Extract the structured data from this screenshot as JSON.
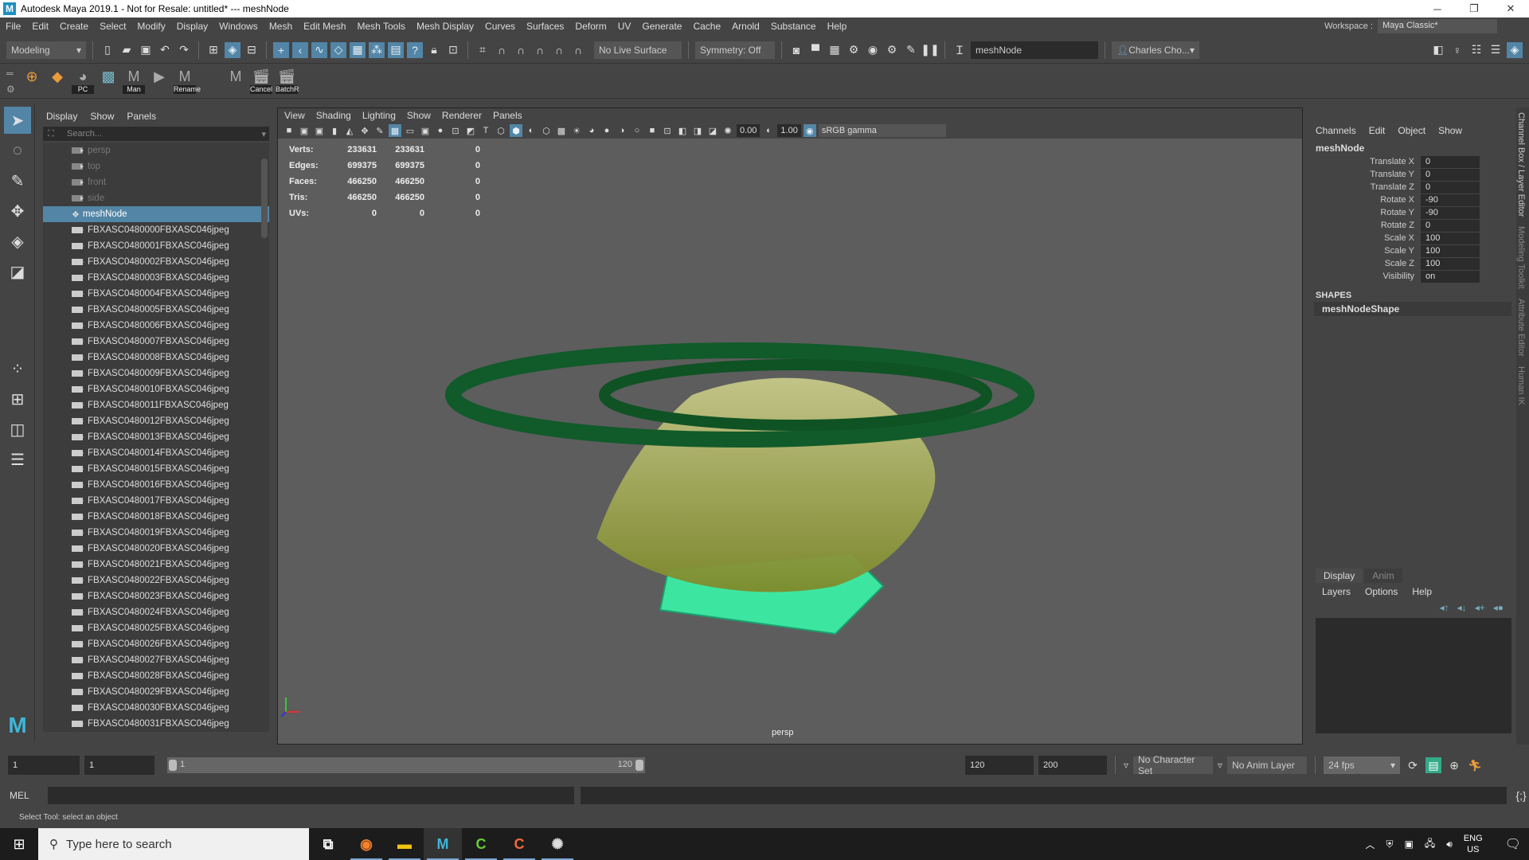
{
  "titlebar": {
    "title": "Autodesk Maya 2019.1 - Not for Resale: untitled*   ---   meshNode",
    "minimize": "─",
    "maximize": "❐",
    "close": "✕"
  },
  "menubar": {
    "items": [
      "File",
      "Edit",
      "Create",
      "Select",
      "Modify",
      "Display",
      "Windows",
      "Mesh",
      "Edit Mesh",
      "Mesh Tools",
      "Mesh Display",
      "Curves",
      "Surfaces",
      "Deform",
      "UV",
      "Generate",
      "Cache",
      "Arnold",
      "Substance",
      "Help"
    ],
    "workspace_label": "Workspace :",
    "workspace_value": "Maya Classic*"
  },
  "statusline": {
    "menuset": "Modeling",
    "live_surface": "No Live Surface",
    "symmetry": "Symmetry: Off",
    "name_field": "meshNode",
    "user": "Charles Cho..."
  },
  "shelf": {
    "buttons": [
      "PC",
      "Man",
      "Rename",
      "Cancel",
      "BatchR"
    ]
  },
  "outliner": {
    "menu": [
      "Display",
      "Show",
      "Panels"
    ],
    "search_placeholder": "Search...",
    "items": [
      {
        "label": "persp",
        "type": "camera",
        "dim": true
      },
      {
        "label": "top",
        "type": "camera",
        "dim": true
      },
      {
        "label": "front",
        "type": "camera",
        "dim": true
      },
      {
        "label": "side",
        "type": "camera",
        "dim": true
      },
      {
        "label": "meshNode",
        "type": "mesh",
        "selected": true
      },
      {
        "label": "FBXASC0480000FBXASC046jpeg",
        "type": "camera"
      },
      {
        "label": "FBXASC0480001FBXASC046jpeg",
        "type": "camera"
      },
      {
        "label": "FBXASC0480002FBXASC046jpeg",
        "type": "camera"
      },
      {
        "label": "FBXASC0480003FBXASC046jpeg",
        "type": "camera"
      },
      {
        "label": "FBXASC0480004FBXASC046jpeg",
        "type": "camera"
      },
      {
        "label": "FBXASC0480005FBXASC046jpeg",
        "type": "camera"
      },
      {
        "label": "FBXASC0480006FBXASC046jpeg",
        "type": "camera"
      },
      {
        "label": "FBXASC0480007FBXASC046jpeg",
        "type": "camera"
      },
      {
        "label": "FBXASC0480008FBXASC046jpeg",
        "type": "camera"
      },
      {
        "label": "FBXASC0480009FBXASC046jpeg",
        "type": "camera"
      },
      {
        "label": "FBXASC0480010FBXASC046jpeg",
        "type": "camera"
      },
      {
        "label": "FBXASC0480011FBXASC046jpeg",
        "type": "camera"
      },
      {
        "label": "FBXASC0480012FBXASC046jpeg",
        "type": "camera"
      },
      {
        "label": "FBXASC0480013FBXASC046jpeg",
        "type": "camera"
      },
      {
        "label": "FBXASC0480014FBXASC046jpeg",
        "type": "camera"
      },
      {
        "label": "FBXASC0480015FBXASC046jpeg",
        "type": "camera"
      },
      {
        "label": "FBXASC0480016FBXASC046jpeg",
        "type": "camera"
      },
      {
        "label": "FBXASC0480017FBXASC046jpeg",
        "type": "camera"
      },
      {
        "label": "FBXASC0480018FBXASC046jpeg",
        "type": "camera"
      },
      {
        "label": "FBXASC0480019FBXASC046jpeg",
        "type": "camera"
      },
      {
        "label": "FBXASC0480020FBXASC046jpeg",
        "type": "camera"
      },
      {
        "label": "FBXASC0480021FBXASC046jpeg",
        "type": "camera"
      },
      {
        "label": "FBXASC0480022FBXASC046jpeg",
        "type": "camera"
      },
      {
        "label": "FBXASC0480023FBXASC046jpeg",
        "type": "camera"
      },
      {
        "label": "FBXASC0480024FBXASC046jpeg",
        "type": "camera"
      },
      {
        "label": "FBXASC0480025FBXASC046jpeg",
        "type": "camera"
      },
      {
        "label": "FBXASC0480026FBXASC046jpeg",
        "type": "camera"
      },
      {
        "label": "FBXASC0480027FBXASC046jpeg",
        "type": "camera"
      },
      {
        "label": "FBXASC0480028FBXASC046jpeg",
        "type": "camera"
      },
      {
        "label": "FBXASC0480029FBXASC046jpeg",
        "type": "camera"
      },
      {
        "label": "FBXASC0480030FBXASC046jpeg",
        "type": "camera"
      },
      {
        "label": "FBXASC0480031FBXASC046jpeg",
        "type": "camera"
      }
    ]
  },
  "viewport": {
    "menu": [
      "View",
      "Shading",
      "Lighting",
      "Show",
      "Renderer",
      "Panels"
    ],
    "exposure": "0.00",
    "gamma": "1.00",
    "color_space": "sRGB gamma",
    "camera": "persp",
    "hud": [
      {
        "label": "Verts:",
        "a": "233631",
        "b": "233631",
        "c": "0"
      },
      {
        "label": "Edges:",
        "a": "699375",
        "b": "699375",
        "c": "0"
      },
      {
        "label": "Faces:",
        "a": "466250",
        "b": "466250",
        "c": "0"
      },
      {
        "label": "Tris:",
        "a": "466250",
        "b": "466250",
        "c": "0"
      },
      {
        "label": "UVs:",
        "a": "0",
        "b": "0",
        "c": "0"
      }
    ]
  },
  "channelbox": {
    "menu": [
      "Channels",
      "Edit",
      "Object",
      "Show"
    ],
    "node": "meshNode",
    "channels": [
      {
        "k": "Translate X",
        "v": "0"
      },
      {
        "k": "Translate Y",
        "v": "0"
      },
      {
        "k": "Translate Z",
        "v": "0"
      },
      {
        "k": "Rotate X",
        "v": "-90"
      },
      {
        "k": "Rotate Y",
        "v": "-90"
      },
      {
        "k": "Rotate Z",
        "v": "0"
      },
      {
        "k": "Scale X",
        "v": "100"
      },
      {
        "k": "Scale Y",
        "v": "100"
      },
      {
        "k": "Scale Z",
        "v": "100"
      },
      {
        "k": "Visibility",
        "v": "on"
      }
    ],
    "shapes_label": "SHAPES",
    "shape": "meshNodeShape"
  },
  "side_tabs": [
    "Channel Box / Layer Editor",
    "Modeling Toolkit",
    "Attribute Editor",
    "Human IK"
  ],
  "layers": {
    "tabs": [
      "Display",
      "Anim"
    ],
    "menu": [
      "Layers",
      "Options",
      "Help"
    ]
  },
  "timeline": {
    "start": "1",
    "current": "1",
    "range_start": "1",
    "range_end": "120",
    "end": "120",
    "anim_end": "200",
    "character_set": "No Character Set",
    "anim_layer": "No Anim Layer",
    "fps": "24 fps"
  },
  "commandline": {
    "lang": "MEL"
  },
  "helpline": {
    "text": "Select Tool: select an object"
  },
  "taskbar": {
    "search_placeholder": "Type here to search",
    "lang_top": "ENG",
    "lang_bottom": "US"
  }
}
